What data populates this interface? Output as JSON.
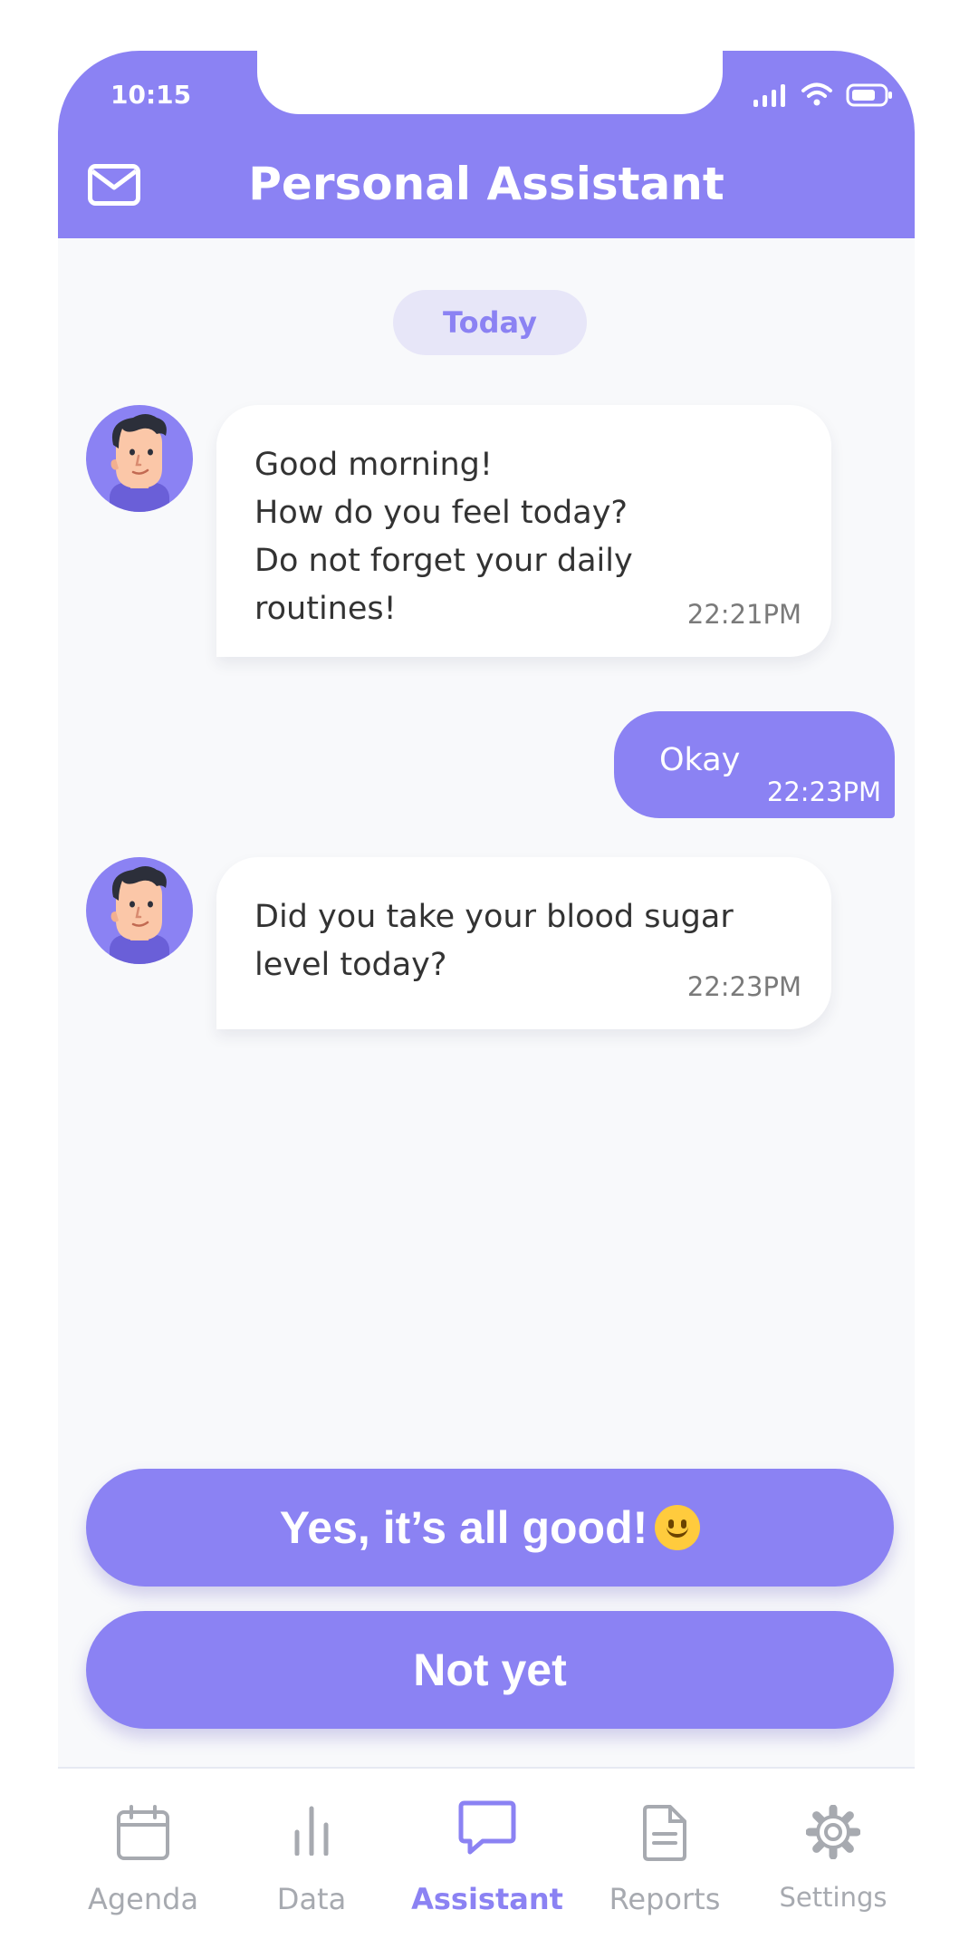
{
  "status_bar": {
    "time": "10:15"
  },
  "header": {
    "title": "Personal Assistant"
  },
  "chat": {
    "date_label": "Today",
    "messages": [
      {
        "from": "assistant",
        "text": "Good morning!\nHow do you feel today?\nDo not forget your daily routines!",
        "time": "22:21PM"
      },
      {
        "from": "user",
        "text": "Okay",
        "time": "22:23PM"
      },
      {
        "from": "assistant",
        "text": "Did you take your blood sugar level today?",
        "time": "22:23PM"
      }
    ]
  },
  "answers": [
    {
      "label": "Yes, it’s all good!",
      "emoji": "slightly-smiling-face"
    },
    {
      "label": "Not yet"
    }
  ],
  "tabs": [
    {
      "label": "Agenda",
      "icon": "calendar-icon",
      "active": false
    },
    {
      "label": "Data",
      "icon": "bar-chart-icon",
      "active": false
    },
    {
      "label": "Assistant",
      "icon": "chat-bubble-icon",
      "active": true
    },
    {
      "label": "Reports",
      "icon": "document-icon",
      "active": false
    },
    {
      "label": "Settings",
      "icon": "gear-icon",
      "active": false
    }
  ],
  "colors": {
    "accent": "#8b82f3",
    "background": "#f8f9fb",
    "inactive": "#a7aab0"
  }
}
